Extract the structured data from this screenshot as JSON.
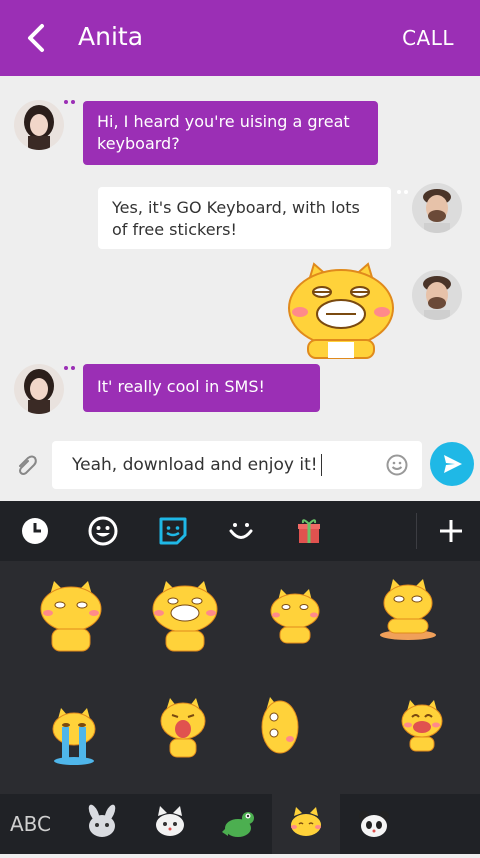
{
  "header": {
    "title": "Anita",
    "call_label": "CALL"
  },
  "messages": [
    {
      "side": "incoming",
      "text_lines": [
        "Hi, I heard you're uising a great",
        "keyboard?"
      ]
    },
    {
      "side": "outgoing",
      "text_lines": [
        "Yes, it's GO Keyboard, with lots",
        "of free stickers!"
      ]
    },
    {
      "side": "outgoing",
      "sticker": "grinning-cat-sticker"
    },
    {
      "side": "incoming",
      "text_lines": [
        "It' really cool in SMS!"
      ]
    }
  ],
  "composer": {
    "value": "Yeah, download and enjoy it!"
  },
  "keyboard": {
    "top_icons": [
      "clock-icon",
      "smiley-icon",
      "sticker-icon",
      "emoticon-icon",
      "gift-icon",
      "plus-icon"
    ],
    "bottom_tabs": [
      "ABC",
      "rabbit-pack",
      "cat-pack",
      "crocodile-pack",
      "yellow-cat-pack",
      "panda-pack"
    ],
    "abc_label": "ABC",
    "stickers": [
      "cat-sitting",
      "cat-grinning",
      "cat-waving",
      "cat-lying",
      "cat-crying",
      "cat-laughing",
      "cat-peeking",
      "cat-cheering"
    ]
  },
  "colors": {
    "brand": "#9b2fb5",
    "send": "#1fb8e6",
    "sticker_yellow": "#ffd23a"
  }
}
